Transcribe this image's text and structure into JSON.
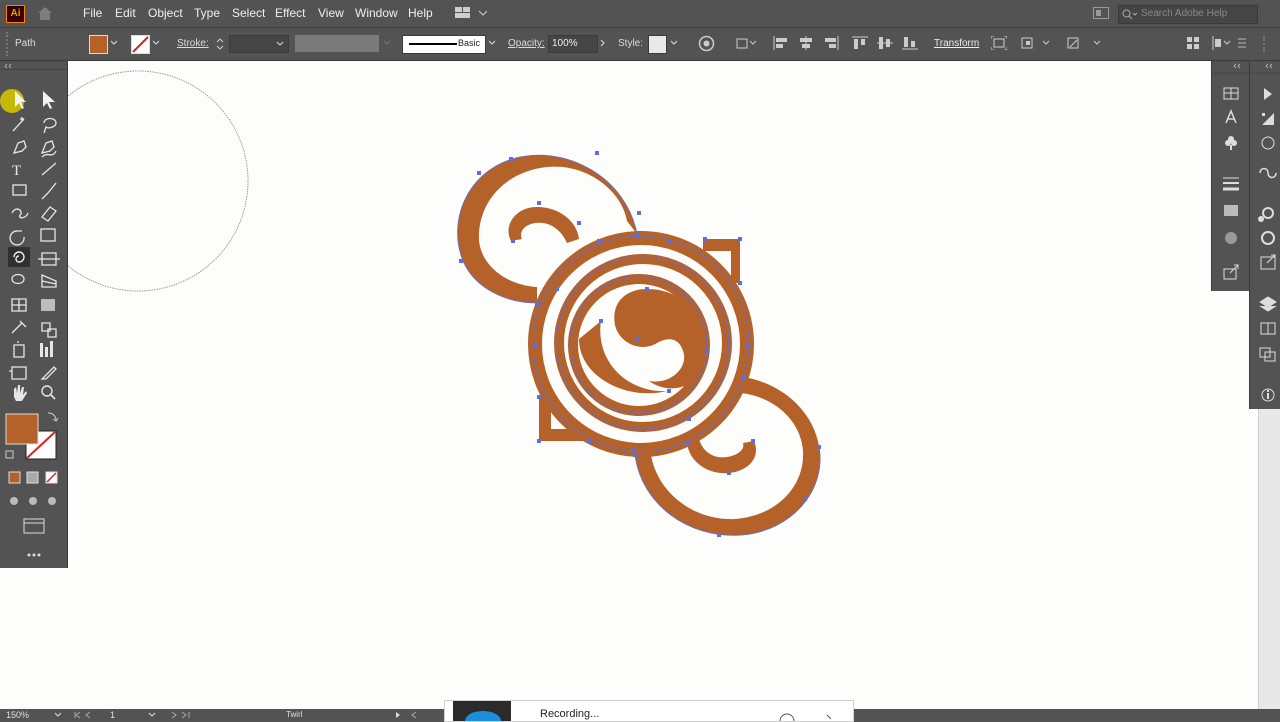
{
  "app": {
    "logo_text": "Ai",
    "menus": [
      "File",
      "Edit",
      "Object",
      "Type",
      "Select",
      "Effect",
      "View",
      "Window",
      "Help"
    ],
    "search_placeholder": "Search Adobe Help"
  },
  "control": {
    "selection_type": "Path",
    "stroke_label": "Stroke:",
    "brush_label": "Basic",
    "opacity_label": "Opacity:",
    "opacity_value": "100%",
    "style_label": "Style:",
    "transform_label": "Transform"
  },
  "colors": {
    "fill": "#b5612a",
    "accent": "#ff9a00",
    "anchor": "#5b6fe0"
  },
  "tools": [
    "selection-tool",
    "direct-selection-tool",
    "magic-wand-tool",
    "lasso-tool",
    "pen-tool",
    "curvature-tool",
    "type-tool",
    "line-tool",
    "rectangle-tool",
    "paintbrush-tool",
    "shaper-tool",
    "eraser-tool",
    "rotate-tool",
    "scale-tool",
    "twirl-tool",
    "free-transform-tool",
    "shape-builder-tool",
    "perspective-grid-tool",
    "mesh-tool",
    "gradient-tool",
    "eyedropper-tool",
    "blend-tool",
    "symbol-sprayer-tool",
    "column-graph-tool",
    "artboard-tool",
    "slice-tool",
    "hand-tool",
    "zoom-tool"
  ],
  "status": {
    "zoom": "150%",
    "artboard": "1",
    "current_tool": "Twirl",
    "recording": "Recording..."
  }
}
